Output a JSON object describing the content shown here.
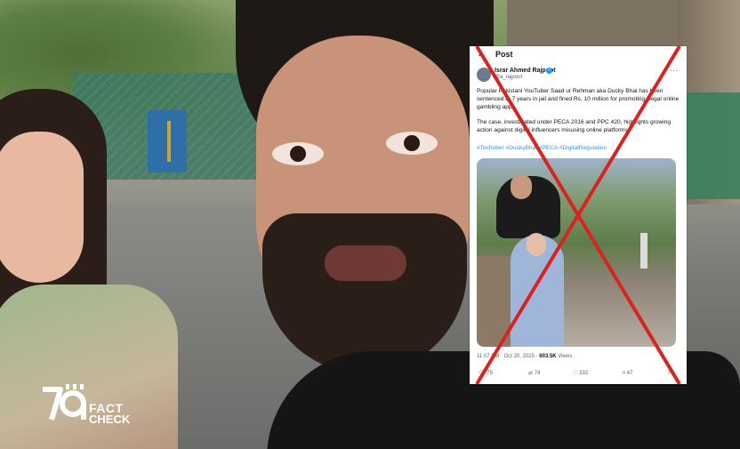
{
  "logo": {
    "mark": "79",
    "line1": "FACT",
    "line2": "CHECK"
  },
  "post": {
    "title": "Post",
    "author_name": "Israr Ahmed Rajpoot",
    "handle": "@a_rajpoot",
    "text_p1": "Popular Pakistani YouTuber Saad ur Rehman aka Ducky Bhai has been sentenced to 7 years in jail and fined Rs. 10 million for promoting illegal online gambling apps.",
    "text_p2": "The case, investigated under PECA 2016 and PPC 420, highlights growing action against digital influencers misusing online platforms.",
    "hashtags": "#Techober #DuckyBhai #PECA #DigitalRegulation",
    "timestamp": "11:07 PM · Oct 20, 2025 · ",
    "views_count": "603.5K",
    "views_label": " Views",
    "replies": "75",
    "reposts": "74",
    "likes": "332",
    "bookmarks": "47"
  },
  "icons": {
    "back": "arrow-left-icon",
    "verified": "verified-badge-icon",
    "more": "more-icon",
    "reply": "reply-icon",
    "repost": "repost-icon",
    "like": "heart-icon",
    "bookmark": "bookmark-icon",
    "share": "share-icon"
  },
  "colors": {
    "cross": "#d9231f",
    "link": "#1d9bf0",
    "verified": "#1d9bf0"
  }
}
